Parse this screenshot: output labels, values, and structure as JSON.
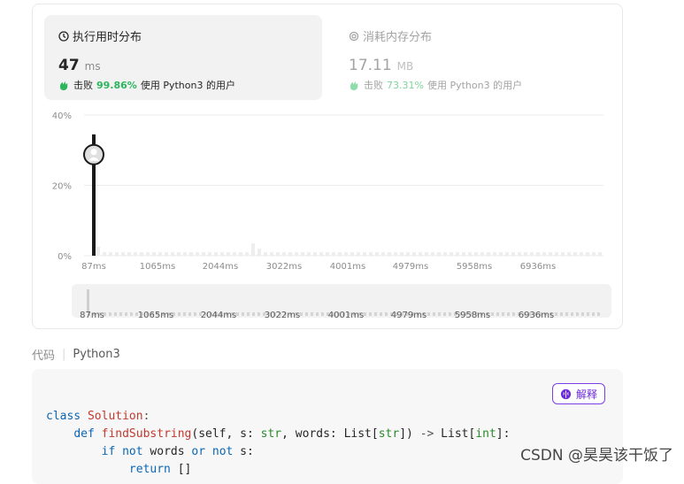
{
  "runtime": {
    "title": "执行用时分布",
    "value": "47",
    "unit": "ms",
    "beats_prefix": "击败",
    "beats_pct": "99.86%",
    "beats_suffix": "使用 Python3 的用户",
    "icon": "clock-icon"
  },
  "memory": {
    "title": "消耗内存分布",
    "value": "17.11",
    "unit": "MB",
    "beats_prefix": "击败",
    "beats_pct": "73.31%",
    "beats_suffix": "使用 Python3 的用户",
    "icon": "chip-icon"
  },
  "chart_data": {
    "type": "bar",
    "y_ticks": [
      "40%",
      "20%",
      "0%"
    ],
    "x_ticks": [
      "87ms",
      "1065ms",
      "2044ms",
      "3022ms",
      "4001ms",
      "4979ms",
      "5958ms",
      "6936ms"
    ],
    "ylim": [
      0,
      40
    ],
    "highlight": {
      "x": "87ms",
      "value": 30
    }
  },
  "range_slider": {
    "ticks": [
      "87ms",
      "1065ms",
      "2044ms",
      "3022ms",
      "4001ms",
      "4979ms",
      "5958ms",
      "6936ms"
    ]
  },
  "code_section": {
    "label": "代码",
    "language": "Python3",
    "explain_label": "解释",
    "lines": [
      "class Solution:",
      "    def findSubstring(self, s: str, words: List[str]) -> List[int]:",
      "        if not words or not s:",
      "            return []"
    ]
  },
  "watermark": "CSDN @昊昊该干饭了"
}
